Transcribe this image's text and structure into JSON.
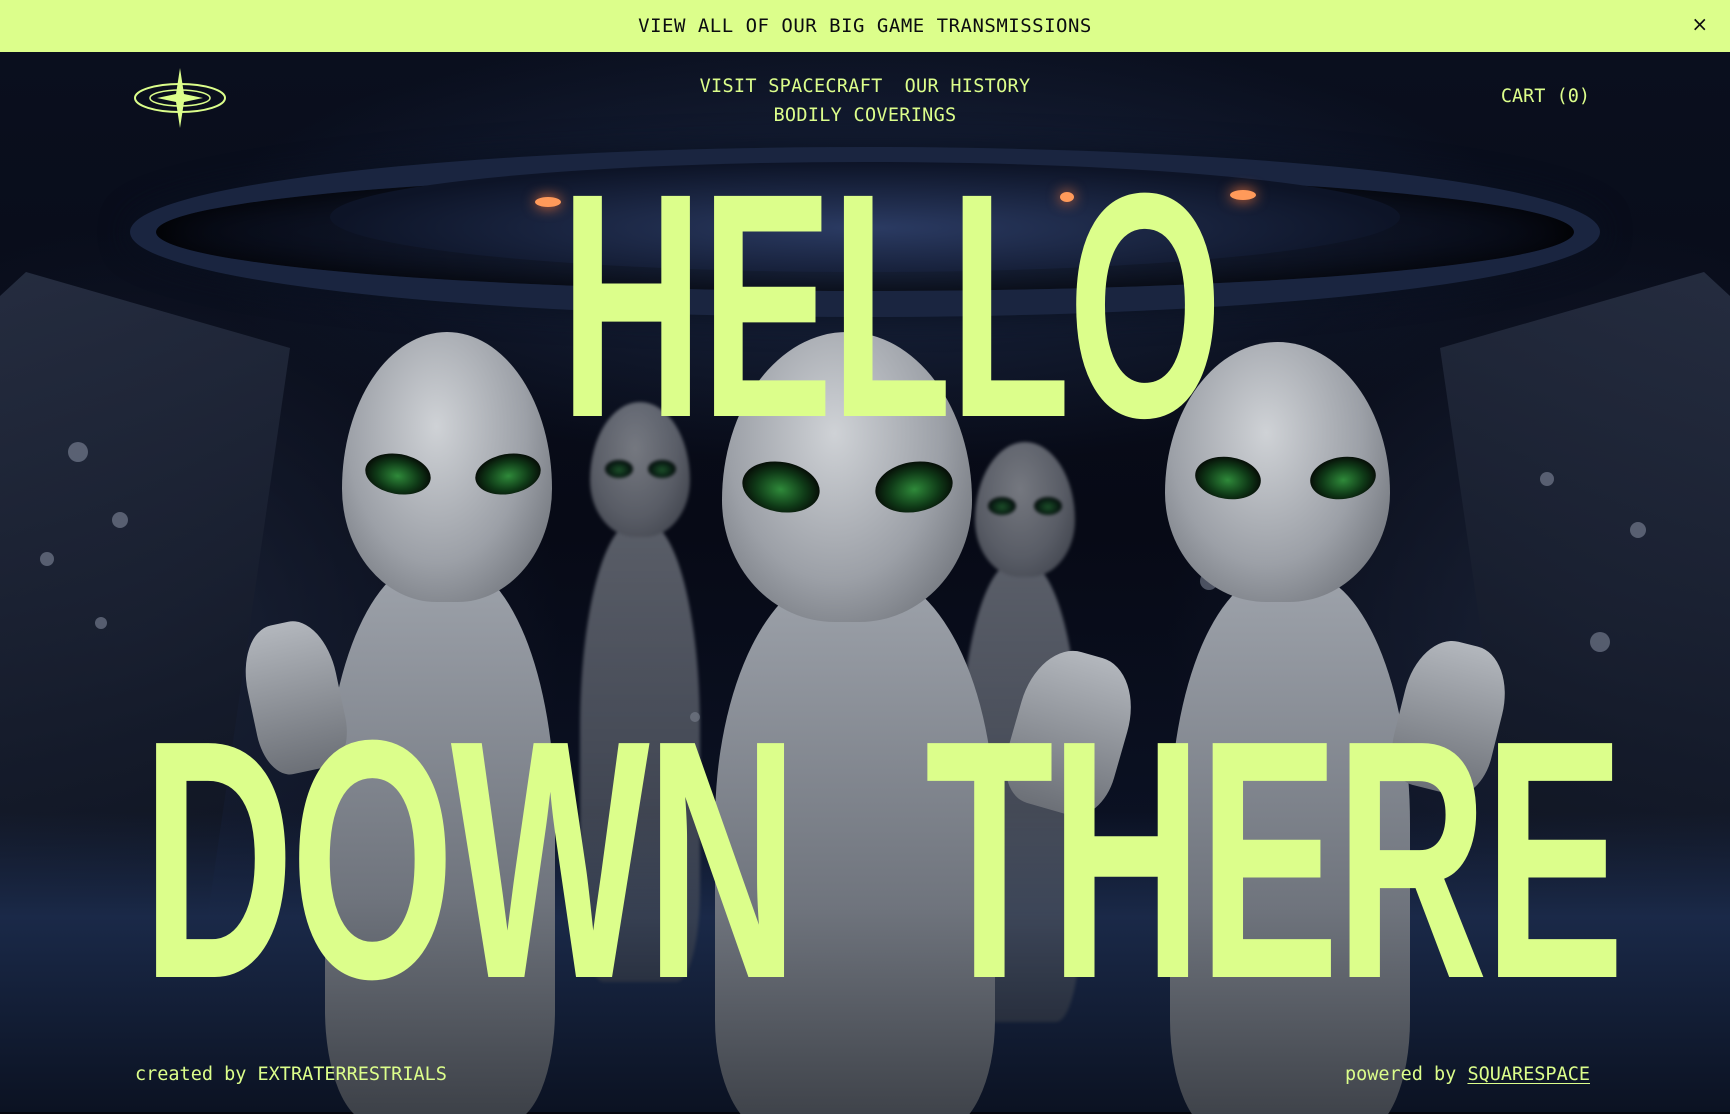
{
  "announcement": {
    "text": "VIEW ALL OF OUR BIG GAME TRANSMISSIONS",
    "close_icon": "×"
  },
  "nav": {
    "logo": "orbit-star-logo",
    "links": [
      "VISIT SPACECRAFT",
      "OUR HISTORY",
      "BODILY COVERINGS"
    ],
    "cart": "CART (0)"
  },
  "hero": {
    "line1": "HELLO",
    "line2_left": "DOWN",
    "line2_right": "THERE",
    "image": "aliens waving aboard spacecraft"
  },
  "footer": {
    "created_prefix": "created by",
    "created_name": "EXTRATERRESTRIALS",
    "powered_prefix": "powered by",
    "powered_link": "SQUARESPACE"
  },
  "colors": {
    "accent": "#dcfe8b",
    "background": "#05060d",
    "announcement_text": "#0b0c10"
  }
}
